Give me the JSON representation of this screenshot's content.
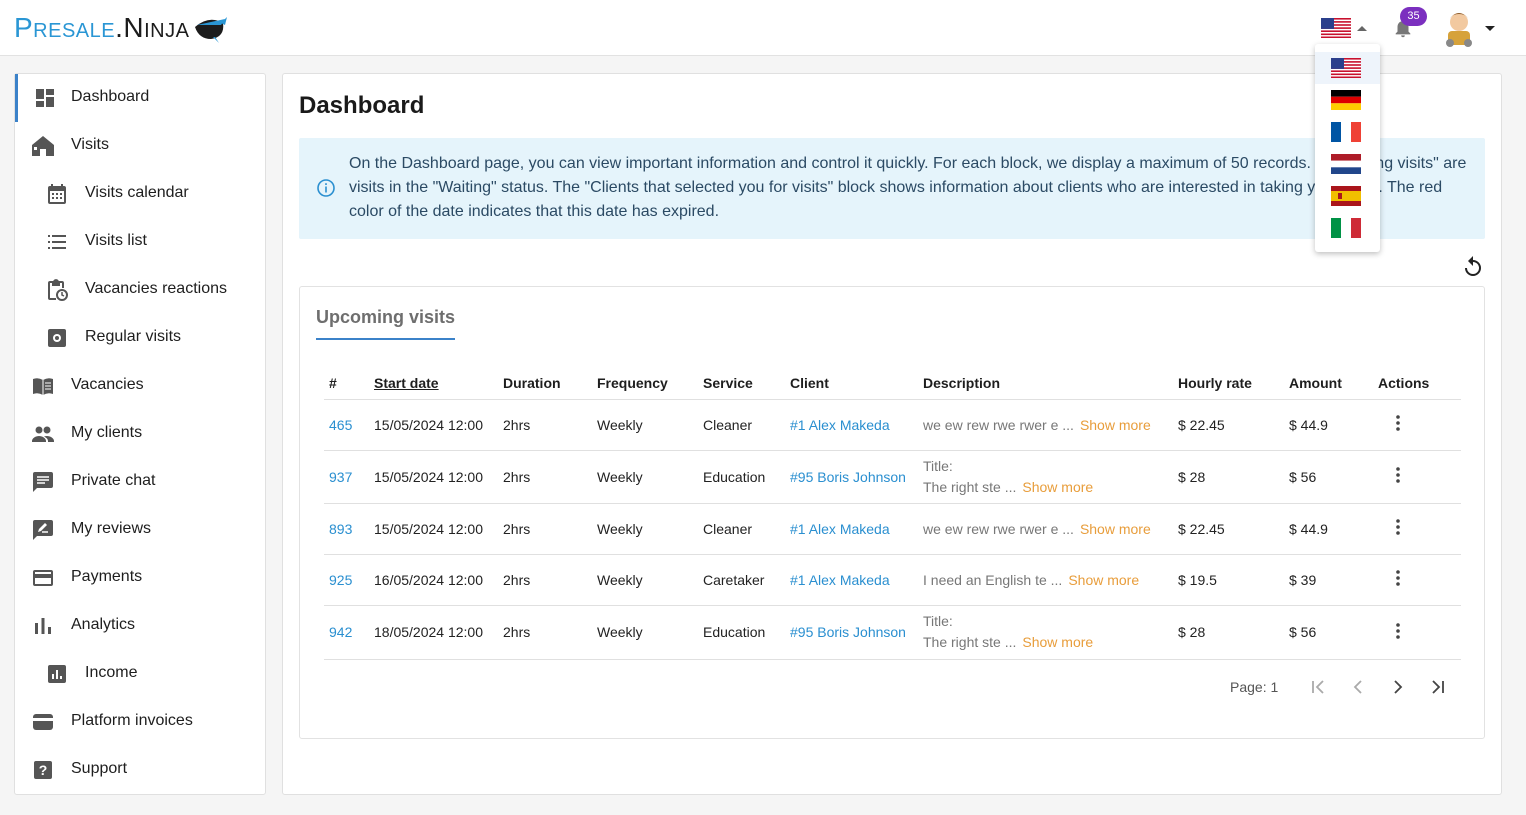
{
  "brand": {
    "part1": "Presale",
    "dot": ".",
    "part2": "Ninja"
  },
  "header": {
    "notifications_count": "35",
    "current_language": "en-US"
  },
  "languages": [
    {
      "code": "en",
      "flag": "us-flag-icon"
    },
    {
      "code": "de",
      "flag": "germany-flag-icon"
    },
    {
      "code": "fr",
      "flag": "france-flag-icon"
    },
    {
      "code": "nl",
      "flag": "netherlands-flag-icon"
    },
    {
      "code": "es",
      "flag": "spain-flag-icon"
    },
    {
      "code": "it",
      "flag": "italy-flag-icon"
    }
  ],
  "sidebar": {
    "items": [
      {
        "label": "Dashboard",
        "icon": "dashboard-icon",
        "active": true
      },
      {
        "label": "Visits",
        "icon": "house-icon"
      },
      {
        "label": "Visits calendar",
        "icon": "calendar-icon",
        "sub": true
      },
      {
        "label": "Visits list",
        "icon": "list-icon",
        "sub": true
      },
      {
        "label": "Vacancies reactions",
        "icon": "clipboard-clock-icon",
        "sub": true
      },
      {
        "label": "Regular visits",
        "icon": "gear-box-icon",
        "sub": true
      },
      {
        "label": "Vacancies",
        "icon": "book-icon"
      },
      {
        "label": "My clients",
        "icon": "people-icon"
      },
      {
        "label": "Private chat",
        "icon": "chat-icon"
      },
      {
        "label": "My reviews",
        "icon": "review-icon"
      },
      {
        "label": "Payments",
        "icon": "credit-card-icon"
      },
      {
        "label": "Analytics",
        "icon": "bar-chart-icon"
      },
      {
        "label": "Income",
        "icon": "income-chart-icon",
        "sub": true
      },
      {
        "label": "Platform invoices",
        "icon": "wallet-icon"
      },
      {
        "label": "Support",
        "icon": "question-icon"
      }
    ]
  },
  "main": {
    "title": "Dashboard",
    "info_text": "On the Dashboard page, you can view important information and control it quickly. For each block, we display a maximum of 50 records. \"Upcoming visits\" are visits in the \"Waiting\" status. The \"Clients that selected you for visits\" block shows information about clients who are interested in taking your visits. The red color of the date indicates that this date has expired.",
    "tab_label": "Upcoming visits",
    "table": {
      "headers": [
        "#",
        "Start date",
        "Duration",
        "Frequency",
        "Service",
        "Client",
        "Description",
        "Hourly rate",
        "Amount",
        "Actions"
      ],
      "show_more_label": "Show more",
      "rows": [
        {
          "id": "465",
          "start": "15/05/2024 12:00",
          "duration": "2hrs",
          "frequency": "Weekly",
          "service": "Cleaner",
          "client": "#1 Alex Makeda",
          "desc1": "",
          "desc2": "we ew rew rwe rwer e ...",
          "rate": "$ 22.45",
          "amount": "$ 44.9"
        },
        {
          "id": "937",
          "start": "15/05/2024 12:00",
          "duration": "2hrs",
          "frequency": "Weekly",
          "service": "Education",
          "client": "#95 Boris Johnson",
          "desc1": "Title:",
          "desc2": "The right ste ...",
          "rate": "$ 28",
          "amount": "$ 56"
        },
        {
          "id": "893",
          "start": "15/05/2024 12:00",
          "duration": "2hrs",
          "frequency": "Weekly",
          "service": "Cleaner",
          "client": "#1 Alex Makeda",
          "desc1": "",
          "desc2": "we ew rew rwe rwer e ...",
          "rate": "$ 22.45",
          "amount": "$ 44.9"
        },
        {
          "id": "925",
          "start": "16/05/2024 12:00",
          "duration": "2hrs",
          "frequency": "Weekly",
          "service": "Caretaker",
          "client": "#1 Alex Makeda",
          "desc1": "",
          "desc2": "I need an English te ...",
          "rate": "$ 19.5",
          "amount": "$ 39"
        },
        {
          "id": "942",
          "start": "18/05/2024 12:00",
          "duration": "2hrs",
          "frequency": "Weekly",
          "service": "Education",
          "client": "#95 Boris Johnson",
          "desc1": "Title:",
          "desc2": "The right ste ...",
          "rate": "$ 28",
          "amount": "$ 56"
        }
      ]
    },
    "pager": {
      "label": "Page: 1"
    }
  },
  "colors": {
    "accent": "#3b82c9",
    "link": "#2a8fd0",
    "show_more": "#e89d3b",
    "info_bg": "#e5f4fb",
    "badge": "#7b2fbf"
  }
}
